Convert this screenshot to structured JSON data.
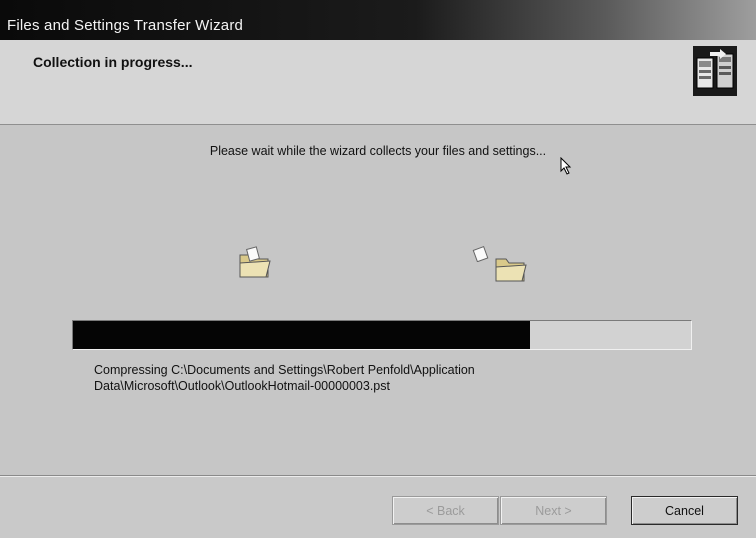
{
  "window": {
    "title": "Files and Settings Transfer Wizard"
  },
  "header": {
    "title": "Collection in progress...",
    "icon": "wizard-transfer-icon"
  },
  "main": {
    "instruction": "Please wait while the wizard collects your files and settings...",
    "progress": 0.74,
    "status_line1": "Compressing C:\\Documents and Settings\\Robert Penfold\\Application",
    "status_line2": "Data\\Microsoft\\Outlook\\OutlookHotmail-00000003.pst"
  },
  "buttons": {
    "back": "< Back",
    "next": "Next >",
    "cancel": "Cancel"
  },
  "colors": {
    "progress_fill": "#050505",
    "title_bar": "#0a0a0a"
  }
}
